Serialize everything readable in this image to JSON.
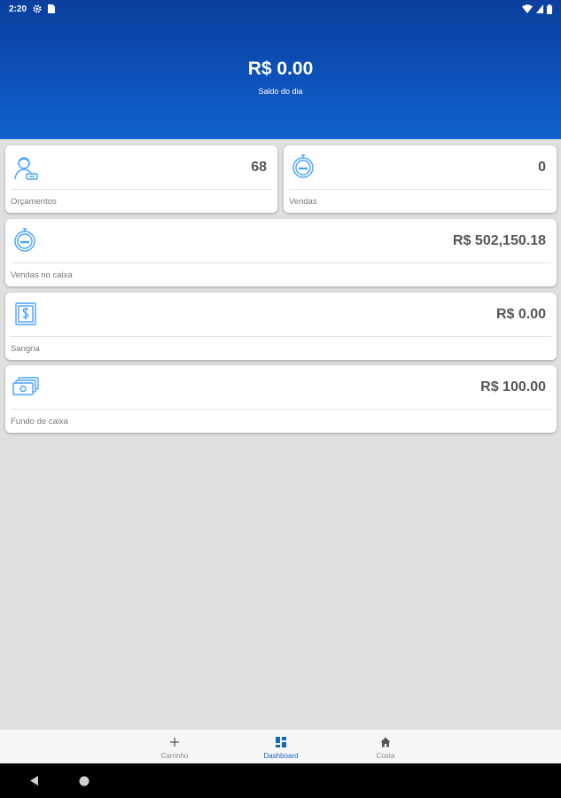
{
  "status_bar": {
    "time": "2:20"
  },
  "header": {
    "balance": "R$ 0.00",
    "caption": "Saldo do dia"
  },
  "cards": {
    "orcamentos": {
      "value": "68",
      "label": "Orçamentos"
    },
    "vendas": {
      "value": "0",
      "label": "Vendas"
    },
    "vendas_caixa": {
      "value": "R$ 502,150.18",
      "label": "Vendas no caixa"
    },
    "sangria": {
      "value": "R$ 0.00",
      "label": "Sangria"
    },
    "fundo_caixa": {
      "value": "R$ 100.00",
      "label": "Fundo de caixa"
    }
  },
  "bottom_nav": {
    "items": [
      {
        "label": "Carrinho",
        "icon": "plus-icon"
      },
      {
        "label": "Dashboard",
        "icon": "dashboard-icon",
        "active": true
      },
      {
        "label": "Costa",
        "icon": "home-icon"
      }
    ]
  },
  "colors": {
    "primary": "#0e56c0",
    "icon_blue": "#4aa3ff",
    "active_nav": "#1565c0",
    "background": "#e0e0e0"
  }
}
